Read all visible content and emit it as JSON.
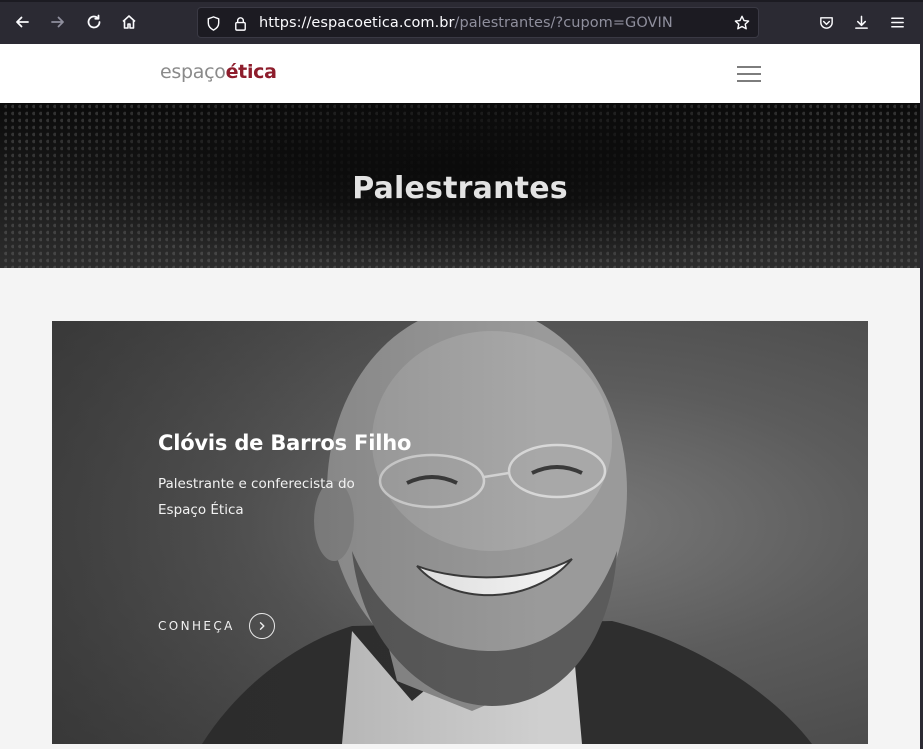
{
  "browser": {
    "url_domain": "https://espacoetica.com.br",
    "url_path": "/palestrantes/?cupom=GOVIN",
    "icons": [
      "back-icon",
      "forward-icon",
      "reload-icon",
      "home-icon",
      "shield-icon",
      "lock-icon",
      "star-icon",
      "pocket-icon",
      "download-icon",
      "menu-icon"
    ]
  },
  "site": {
    "logo_part1": "espaço",
    "logo_part2": "ética",
    "brand_color": "#8e1d2c"
  },
  "hero": {
    "title": "Palestrantes"
  },
  "speaker": {
    "name": "Clóvis de Barros Filho",
    "description": "Palestrante e conferecista do Espaço Ética",
    "cta_label": "CONHEÇA"
  }
}
